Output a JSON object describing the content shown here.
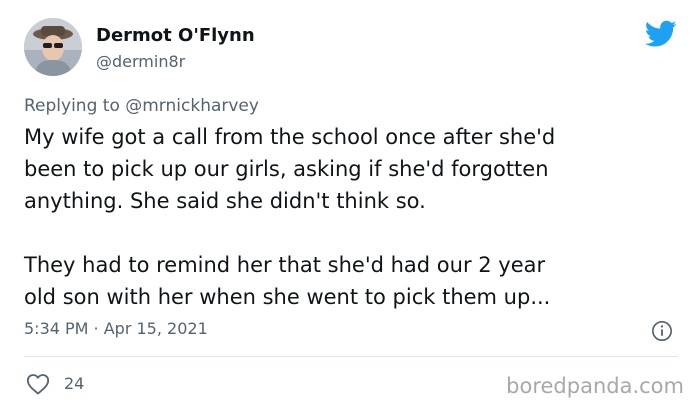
{
  "tweet": {
    "author": {
      "display_name": "Dermot O'Flynn",
      "handle": "@dermin8r",
      "avatar_icon": "profile-photo"
    },
    "reply_prefix": "Replying to ",
    "reply_to": "@mrnickharvey",
    "text_lines": [
      "My wife got a call from the school once after she'd",
      "been to pick up our girls, asking if she'd forgotten",
      "anything. She said she didn't think so.",
      "",
      "They had to remind her that she'd had our 2 year",
      "old son with her when she went to pick them up..."
    ],
    "timestamp": "5:34 PM · Apr 15, 2021",
    "likes": "24"
  },
  "icons": {
    "brand": "twitter-bird-icon",
    "info": "info-icon",
    "like": "heart-icon"
  },
  "colors": {
    "brand": "#1da1f2",
    "secondary_text": "#536471",
    "primary_text": "#0f1419"
  },
  "watermark": "boredpanda.com"
}
